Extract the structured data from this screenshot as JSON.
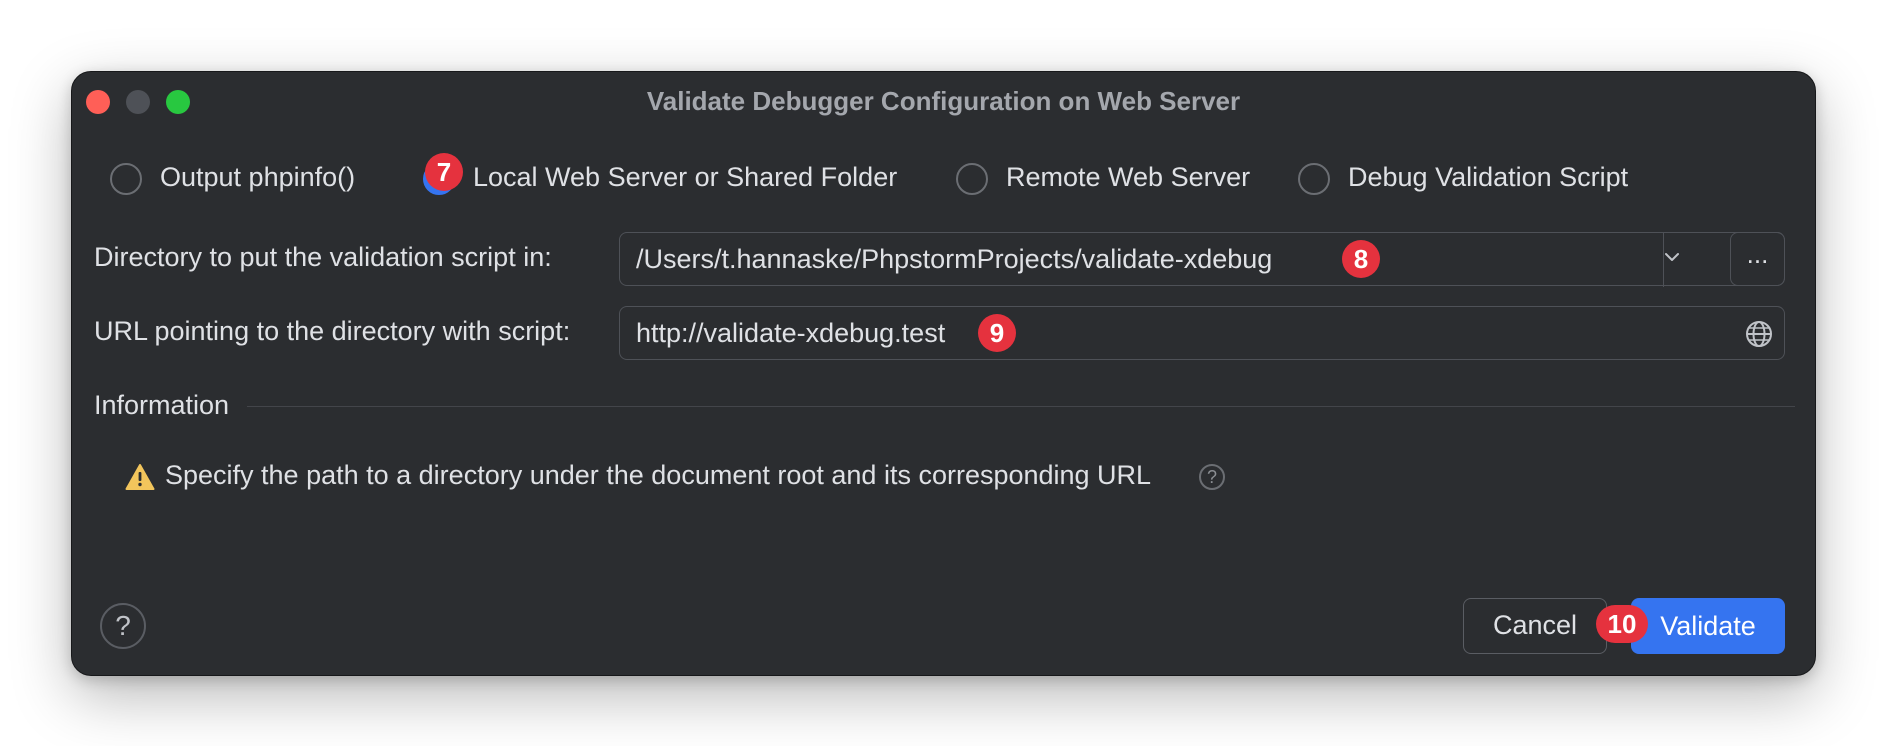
{
  "window": {
    "title": "Validate Debugger Configuration on Web Server"
  },
  "options": [
    {
      "label": "Output phpinfo()",
      "selected": false
    },
    {
      "label": "Local Web Server or Shared Folder",
      "selected": true
    },
    {
      "label": "Remote Web Server",
      "selected": false
    },
    {
      "label": "Debug Validation Script",
      "selected": false
    }
  ],
  "fields": {
    "directory": {
      "label": "Directory to put the validation script in:",
      "value": "/Users/t.hannaske/PhpstormProjects/validate-xdebug",
      "browse_label": "..."
    },
    "url": {
      "label": "URL pointing to the directory with script:",
      "value": "http://validate-xdebug.test"
    }
  },
  "information": {
    "title": "Information",
    "message": "Specify the path to a directory under the document root and its corresponding URL",
    "help_glyph": "?"
  },
  "buttons": {
    "help": "?",
    "cancel": "Cancel",
    "validate": "Validate"
  },
  "badges": {
    "option": "7",
    "directory": "8",
    "url": "9",
    "validate": "10"
  },
  "colors": {
    "accent": "#3574f0",
    "badge": "#e5323e",
    "warning": "#f2c55c",
    "background": "#2b2d30"
  }
}
